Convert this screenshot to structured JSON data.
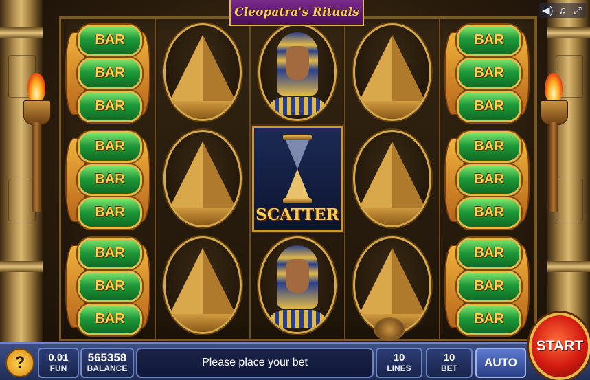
{
  "game": {
    "title": "Cleopatra's Rituals"
  },
  "top_icons": [
    "volume-icon",
    "music-icon",
    "fullscreen-icon"
  ],
  "reels": [
    [
      "BAR3",
      "BAR3",
      "BAR3"
    ],
    [
      "pyramid",
      "pyramid",
      "pyramid"
    ],
    [
      "pharaoh",
      "scatter",
      "pharaoh"
    ],
    [
      "pyramid",
      "pyramid",
      "pyramid"
    ],
    [
      "BAR3",
      "BAR3",
      "BAR3"
    ]
  ],
  "symbols": {
    "bar_label": "BAR",
    "scatter_label": "SCATTER"
  },
  "bottom_bar": {
    "help_label": "?",
    "denomination": {
      "value": "0.01",
      "label": "FUN"
    },
    "balance": {
      "value": "565358",
      "label": "BALANCE"
    },
    "message": "Please place your bet",
    "lines": {
      "value": "10",
      "label": "LINES"
    },
    "bet": {
      "value": "10",
      "label": "BET"
    },
    "auto_label": "AUTO",
    "start_label": "START"
  }
}
